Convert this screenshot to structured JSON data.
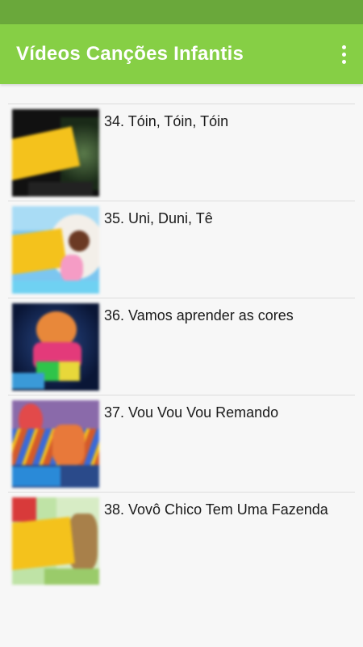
{
  "app_bar": {
    "title": "Vídeos Canções Infantis",
    "overflow_icon": "more-vert-icon"
  },
  "colors": {
    "status_bar": "#6aa83b",
    "app_bar": "#86cf45",
    "background": "#f7f7f7"
  },
  "videos": [
    {
      "title": "34. Tóin, Tóin, Tóin"
    },
    {
      "title": "35. Uni, Duni, Tê"
    },
    {
      "title": "36. Vamos aprender as cores"
    },
    {
      "title": "37. Vou Vou Vou Remando"
    },
    {
      "title": "38. Vovô Chico Tem Uma Fazenda"
    }
  ]
}
